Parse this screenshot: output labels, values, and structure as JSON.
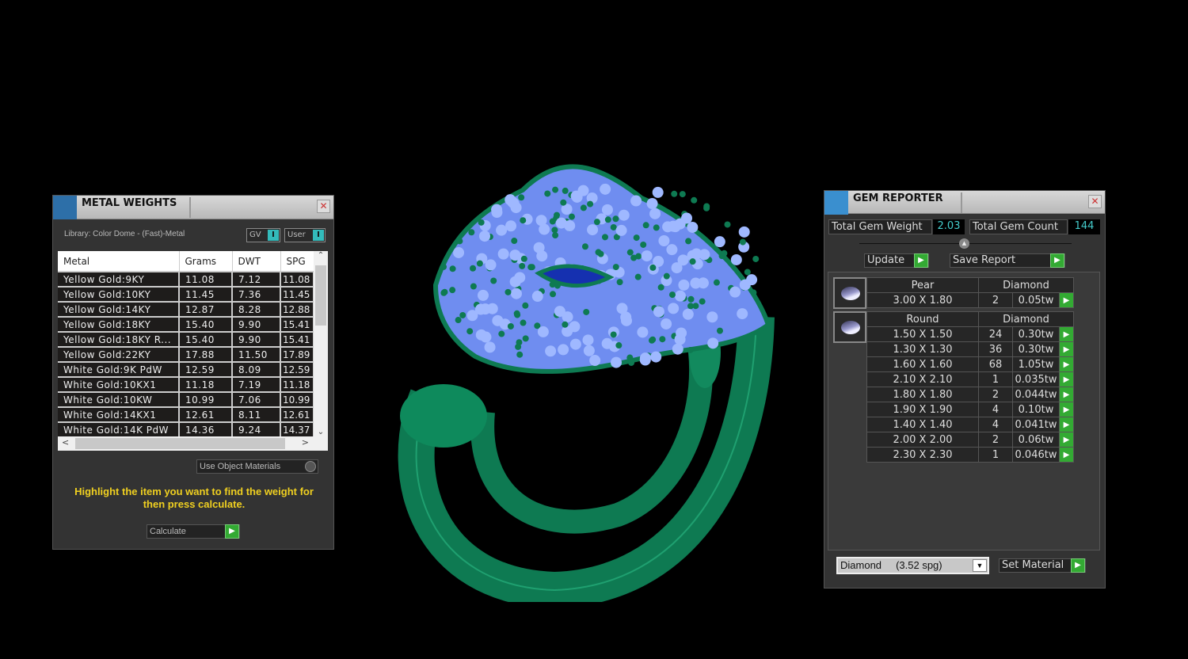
{
  "metal": {
    "title": "METAL WEIGHTS",
    "library": "Library: Color Dome - (Fast)-Metal",
    "toggles": [
      "GV",
      "User"
    ],
    "columns": [
      "Metal",
      "Grams",
      "DWT",
      "SPG"
    ],
    "rows": [
      [
        "Yellow Gold:9KY",
        "11.08",
        "7.12",
        "11.08"
      ],
      [
        "Yellow Gold:10KY",
        "11.45",
        "7.36",
        "11.45"
      ],
      [
        "Yellow Gold:14KY",
        "12.87",
        "8.28",
        "12.88"
      ],
      [
        "Yellow Gold:18KY",
        "15.40",
        "9.90",
        "15.41"
      ],
      [
        "Yellow Gold:18KY R...",
        "15.40",
        "9.90",
        "15.41"
      ],
      [
        "Yellow Gold:22KY",
        "17.88",
        "11.50",
        "17.89"
      ],
      [
        "White Gold:9K PdW",
        "12.59",
        "8.09",
        "12.59"
      ],
      [
        "White Gold:10KX1",
        "11.18",
        "7.19",
        "11.18"
      ],
      [
        "White Gold:10KW",
        "10.99",
        "7.06",
        "10.99"
      ],
      [
        "White Gold:14KX1",
        "12.61",
        "8.11",
        "12.61"
      ],
      [
        "White Gold:14K PdW",
        "14.36",
        "9.24",
        "14.37"
      ]
    ],
    "use_object_materials": "Use Object Materials",
    "hint": "Highlight the item you want to find the weight for then press calculate.",
    "calculate": "Calculate"
  },
  "gem": {
    "title": "GEM REPORTER",
    "total_weight_label": "Total Gem Weight",
    "total_weight": "2.03",
    "total_count_label": "Total Gem Count",
    "total_count": "144",
    "update": "Update",
    "save_report": "Save Report",
    "groups": [
      {
        "shape": "Pear",
        "material": "Diamond",
        "rows": [
          [
            "3.00 X 1.80",
            "2",
            "0.05tw"
          ]
        ]
      },
      {
        "shape": "Round",
        "material": "Diamond",
        "rows": [
          [
            "1.50 X 1.50",
            "24",
            "0.30tw"
          ],
          [
            "1.30 X 1.30",
            "36",
            "0.30tw"
          ],
          [
            "1.60 X 1.60",
            "68",
            "1.05tw"
          ],
          [
            "2.10 X 2.10",
            "1",
            "0.035tw"
          ],
          [
            "1.80 X 1.80",
            "2",
            "0.044tw"
          ],
          [
            "1.90 X 1.90",
            "4",
            "0.10tw"
          ],
          [
            "1.40 X 1.40",
            "4",
            "0.041tw"
          ],
          [
            "2.00 X 2.00",
            "2",
            "0.06tw"
          ],
          [
            "2.30 X 2.30",
            "1",
            "0.046tw"
          ]
        ]
      }
    ],
    "material_select": "Diamond     (3.52 spg)",
    "set_material": "Set Material"
  },
  "colors": {
    "ring": "#0e7a52",
    "gems": "#8aa8ff",
    "hint": "#f0d020",
    "go": "#33aa33"
  }
}
